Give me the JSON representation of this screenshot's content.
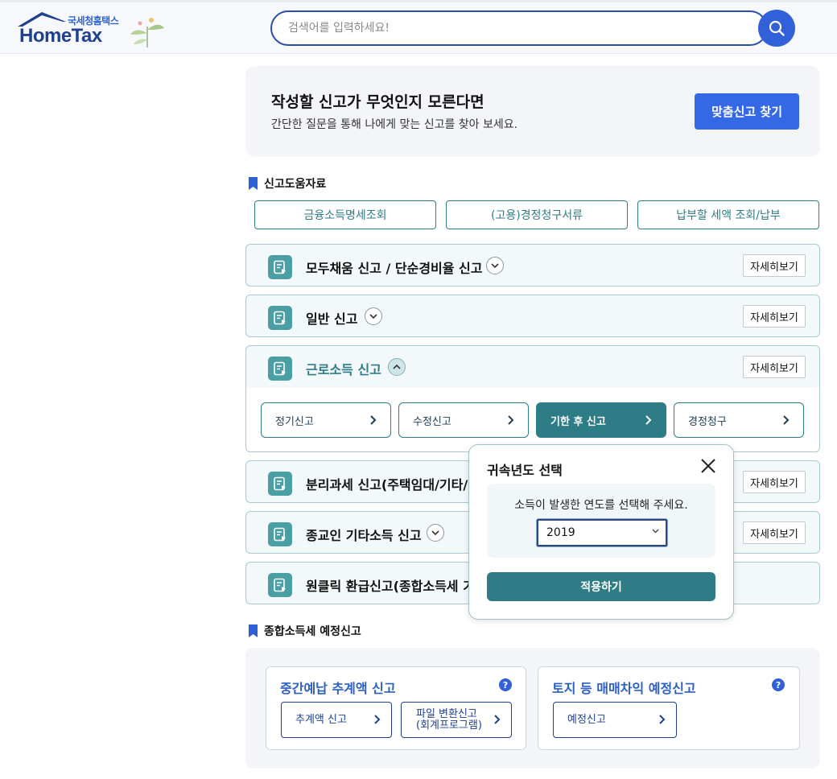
{
  "header": {
    "logo_sub": "국세청홈택스",
    "logo_main": "HomeTax",
    "search_placeholder": "검색어를 입력하세요!"
  },
  "banner": {
    "title": "작성할 신고가 무엇인지 모른다면",
    "desc": "간단한 질문을 통해 나에게 맞는 신고를 찾아 보세요.",
    "button": "맞춤신고 찾기"
  },
  "help_section": {
    "title": "신고도움자료",
    "buttons": [
      "금융소득명세조회",
      "(고용)경정청구서류",
      "납부할 세액 조회/납부"
    ]
  },
  "accordion": {
    "detail_label": "자세히보기",
    "items": [
      {
        "title": "모두채움 신고 / 단순경비율 신고"
      },
      {
        "title": "일반 신고"
      },
      {
        "title": "근로소득 신고"
      },
      {
        "title": "분리과세 신고(주택임대/기타/연"
      },
      {
        "title": "종교인 기타소득 신고"
      },
      {
        "title": "원클릭 환급신고(종합소득세 기"
      }
    ],
    "sub_buttons": [
      "정기신고",
      "수정신고",
      "기한 후 신고",
      "경정청구"
    ]
  },
  "modal": {
    "title": "귀속년도 선택",
    "desc": "소득이 발생한 연도를 선택해 주세요.",
    "selected_year": "2019",
    "apply": "적용하기"
  },
  "estimate_section": {
    "title": "종합소득세 예정신고",
    "cards": [
      {
        "title": "중간예납 추계액 신고",
        "buttons": [
          "추계액 신고",
          "파일 변환신고",
          "(회계프로그램)"
        ]
      },
      {
        "title": "토지 등 매매차익 예정신고",
        "buttons": [
          "예정신고"
        ]
      }
    ],
    "help_glyph": "?"
  },
  "colors": {
    "primary_blue": "#3468e4",
    "teal": "#2e7d86",
    "navy": "#1f3f8f"
  }
}
